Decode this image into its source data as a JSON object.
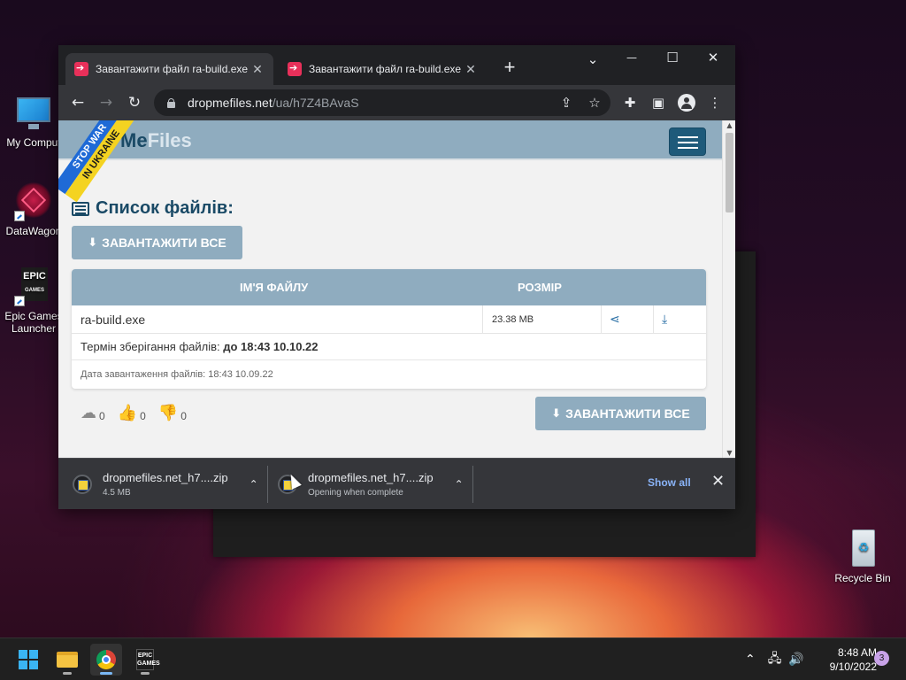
{
  "desktop": {
    "icons": [
      {
        "label": "My Comput"
      },
      {
        "label": "DataWagon"
      },
      {
        "label": "Epic Games Launcher"
      },
      {
        "label": "Recycle Bin"
      }
    ]
  },
  "browser": {
    "tabs": [
      {
        "title": "Завантажити файл ra-build.exe",
        "close": "✕"
      },
      {
        "title": "Завантажити файл ra-build.exe",
        "close": "✕"
      }
    ],
    "new_tab": "+",
    "window_controls": {
      "dropdown": "⌄",
      "minimize": "—",
      "maximize": "☐",
      "close": "✕"
    },
    "url_domain": "dropmefiles.net",
    "url_path": "/ua/h7Z4BAvaS"
  },
  "site": {
    "logo_pre": "",
    "logo_main": "Me",
    "logo_suffix": "Files",
    "ribbon_line1": "STOP WAR",
    "ribbon_line2": "IN UKRAINE",
    "heading": "Список файлів:",
    "download_all": "ЗАВАНТАЖИТИ ВСЕ",
    "table": {
      "col_name": "ІМ'Я ФАЙЛУ",
      "col_size": "РОЗМІР",
      "file_name": "ra-build.exe",
      "file_size": "23.38 MB",
      "storage_label": "Термін зберігання файлів:",
      "storage_value": "до 18:43 10.10.22",
      "upload_date": "Дата завантаження файлів: 18:43 10.09.22"
    },
    "stats": {
      "downloads": "0",
      "likes": "0",
      "dislikes": "0"
    }
  },
  "downloads_bar": {
    "items": [
      {
        "name": "dropmefiles.net_h7....zip",
        "status": "4.5 MB"
      },
      {
        "name": "dropmefiles.net_h7....zip",
        "status": "Opening when complete"
      }
    ],
    "show_all": "Show all",
    "close": "✕"
  },
  "taskbar": {
    "time": "8:48 AM",
    "date": "9/10/2022",
    "notifications": "3"
  }
}
